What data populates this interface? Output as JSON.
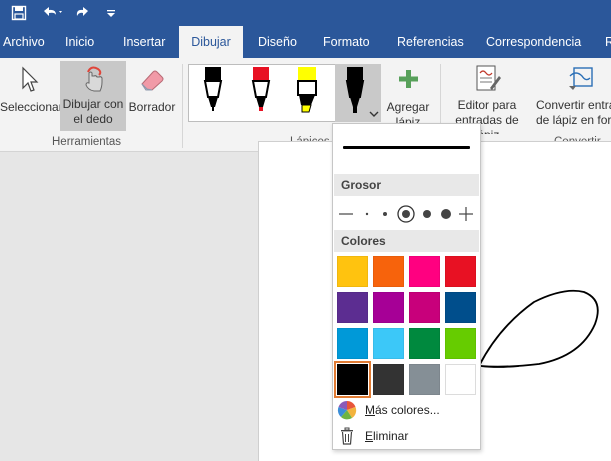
{
  "quick_access": {
    "save": "save-icon",
    "undo": "undo-icon",
    "redo": "redo-icon",
    "customize": "customize-icon"
  },
  "tabs": [
    {
      "label": "Archivo"
    },
    {
      "label": "Inicio"
    },
    {
      "label": "Insertar"
    },
    {
      "label": "Dibujar"
    },
    {
      "label": "Diseño"
    },
    {
      "label": "Formato"
    },
    {
      "label": "Referencias"
    },
    {
      "label": "Correspondencia"
    },
    {
      "label": "R"
    }
  ],
  "active_tab": "Dibujar",
  "ribbon": {
    "herramientas": {
      "label": "Herramientas",
      "seleccionar": "Seleccionar",
      "dibujar_dedo_1": "Dibujar con",
      "dibujar_dedo_2": "el dedo",
      "borrador": "Borrador"
    },
    "lapices": {
      "label": "Lápices",
      "pens": [
        {
          "color": "#000000",
          "type": "pen"
        },
        {
          "color": "#e81123",
          "type": "pen"
        },
        {
          "color": "#ffff00",
          "type": "highlighter"
        },
        {
          "color": "#000000",
          "type": "pen"
        }
      ],
      "agregar_1": "Agregar",
      "agregar_2": "lápiz"
    },
    "convertir": {
      "label": "Convertir",
      "editor_1": "Editor para",
      "editor_2": "entradas de lápiz",
      "convertir_1": "Convertir entra",
      "convertir_2": "de lápiz en for"
    }
  },
  "pen_dropdown": {
    "grosor_label": "Grosor",
    "colores_label": "Colores",
    "colors": [
      "#ffc30f",
      "#f7630c",
      "#ff0080",
      "#e81123",
      "#5c2d91",
      "#a60096",
      "#c8007b",
      "#004e8c",
      "#0099d8",
      "#3cc8f8",
      "#00893e",
      "#66cc00",
      "#000000",
      "#333333",
      "#858f96",
      "#ffffff"
    ],
    "selected_color_index": 12,
    "mas_colores_pre": "",
    "mas_colores_u": "M",
    "mas_colores_post": "ás colores...",
    "eliminar_u": "E",
    "eliminar_post": "liminar",
    "thickness_selected_index": 3
  }
}
